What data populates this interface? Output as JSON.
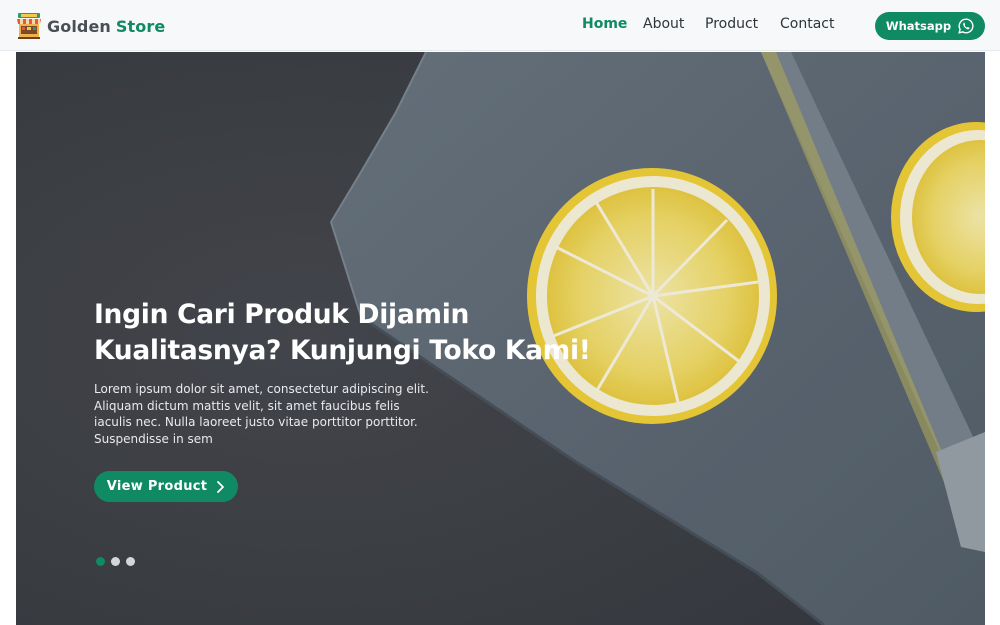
{
  "brand": {
    "word1": "Golden",
    "word2": "Store",
    "logo_icon": "store-awning-icon"
  },
  "nav": {
    "items": [
      {
        "label": "Home",
        "active": true
      },
      {
        "label": "About",
        "active": false
      },
      {
        "label": "Product",
        "active": false
      },
      {
        "label": "Contact",
        "active": false
      }
    ],
    "whatsapp": {
      "label": "Whatsapp",
      "icon": "whatsapp-icon"
    }
  },
  "hero": {
    "title_line1": "Ingin Cari Produk Dijamin",
    "title_line2": "Kualitasnya? Kunjungi Toko Kami!",
    "description": "Lorem ipsum dolor sit amet, consectetur adipiscing elit. Aliquam dictum mattis velit, sit amet faucibus felis iaculis nec. Nulla laoreet justo vitae porttitor porttitor. Suspendisse in sem",
    "cta_label": "View Product",
    "cta_icon": "chevron-right-icon",
    "slides_total": 3,
    "active_slide": 1
  },
  "colors": {
    "accent": "#0f8a63",
    "nav_bg": "#f6f8fa",
    "hero_bg": "#3b3e44"
  }
}
